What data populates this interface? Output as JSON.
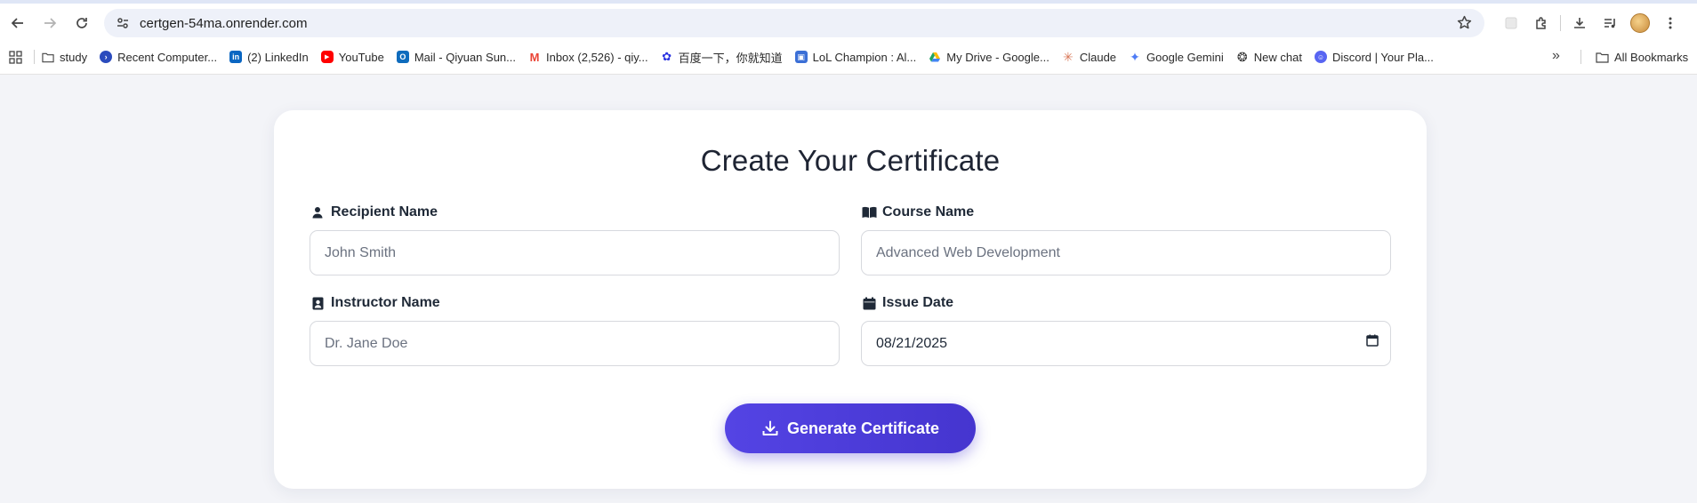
{
  "browser": {
    "url": "certgen-54ma.onrender.com",
    "bookmarks": [
      {
        "label": "study",
        "icon": "folder-icon"
      },
      {
        "label": "Recent Computer...",
        "icon": "site-icon",
        "color": "#2b4bbd"
      },
      {
        "label": "(2) LinkedIn",
        "icon": "linkedin-icon",
        "color": "#0a66c2"
      },
      {
        "label": "YouTube",
        "icon": "youtube-icon",
        "color": "#ff0000"
      },
      {
        "label": "Mail - Qiyuan Sun...",
        "icon": "outlook-icon",
        "color": "#0f6cbd"
      },
      {
        "label": "Inbox (2,526) - qiy...",
        "icon": "gmail-icon",
        "color": "#ea4335"
      },
      {
        "label": "百度一下，你就知道",
        "icon": "baidu-icon",
        "color": "#2932e1"
      },
      {
        "label": "LoL Champion : Al...",
        "icon": "lol-icon",
        "color": "#3b6fd6"
      },
      {
        "label": "My Drive - Google...",
        "icon": "drive-icon",
        "color": "#1fa463"
      },
      {
        "label": "Claude",
        "icon": "claude-icon",
        "color": "#d97757"
      },
      {
        "label": "Google Gemini",
        "icon": "gemini-icon",
        "color": "#4e7cf6"
      },
      {
        "label": "New chat",
        "icon": "openai-icon",
        "color": "#333333"
      },
      {
        "label": "Discord | Your Pla...",
        "icon": "discord-icon",
        "color": "#5865f2"
      }
    ],
    "all_bookmarks": "All Bookmarks"
  },
  "form": {
    "title": "Create Your Certificate",
    "recipient": {
      "label": "Recipient Name",
      "value": "John Smith",
      "icon": "user-icon"
    },
    "course": {
      "label": "Course Name",
      "value": "Advanced Web Development",
      "icon": "book-icon"
    },
    "instructor": {
      "label": "Instructor Name",
      "value": "Dr. Jane Doe",
      "icon": "id-badge-icon"
    },
    "date": {
      "label": "Issue Date",
      "value": "08/21/2025",
      "icon": "calendar-icon"
    },
    "submit_label": "Generate Certificate"
  },
  "colors": {
    "accent": "#4f3fde",
    "page_bg": "#f3f4f8"
  }
}
